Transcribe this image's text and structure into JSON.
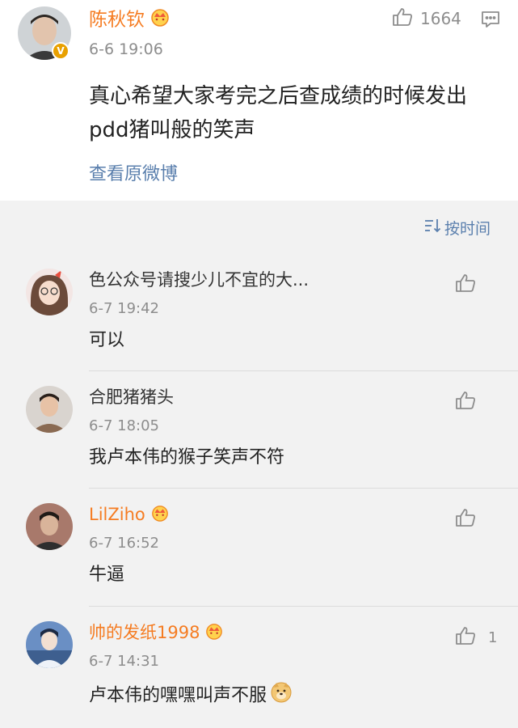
{
  "post": {
    "author": "陈秋钦",
    "time": "6-6 19:06",
    "like_count": "1664",
    "text": "真心希望大家考完之后查成绩的时候发出pdd猪叫般的笑声",
    "view_original": "查看原微博",
    "verify_badge": "V"
  },
  "comments_header": {
    "sort_label": "按时间"
  },
  "comments": [
    {
      "name": "色公众号请搜少儿不宜的大...",
      "time": "6-7 19:42",
      "text": "可以",
      "like_count": "",
      "vip": false
    },
    {
      "name": "合肥猪猪头",
      "time": "6-7 18:05",
      "text": "我卢本伟的猴子笑声不符",
      "like_count": "",
      "vip": false
    },
    {
      "name": "LilZiho",
      "time": "6-7 16:52",
      "text": "牛逼",
      "like_count": "",
      "vip": true
    },
    {
      "name": "帅的发纸1998",
      "time": "6-7 14:31",
      "text": "卢本伟的嘿嘿叫声不服",
      "like_count": "1",
      "vip": true
    }
  ],
  "colors": {
    "vip_name": "#f57c22",
    "link": "#5a7fad",
    "muted": "#8d8d8d",
    "comments_bg": "#f2f2f2"
  },
  "icons": {
    "like": "thumbs-up-icon",
    "comment": "comment-icon",
    "sort": "sort-icon",
    "vip": "crown-icon",
    "emoji": "doge-emoji-icon"
  }
}
